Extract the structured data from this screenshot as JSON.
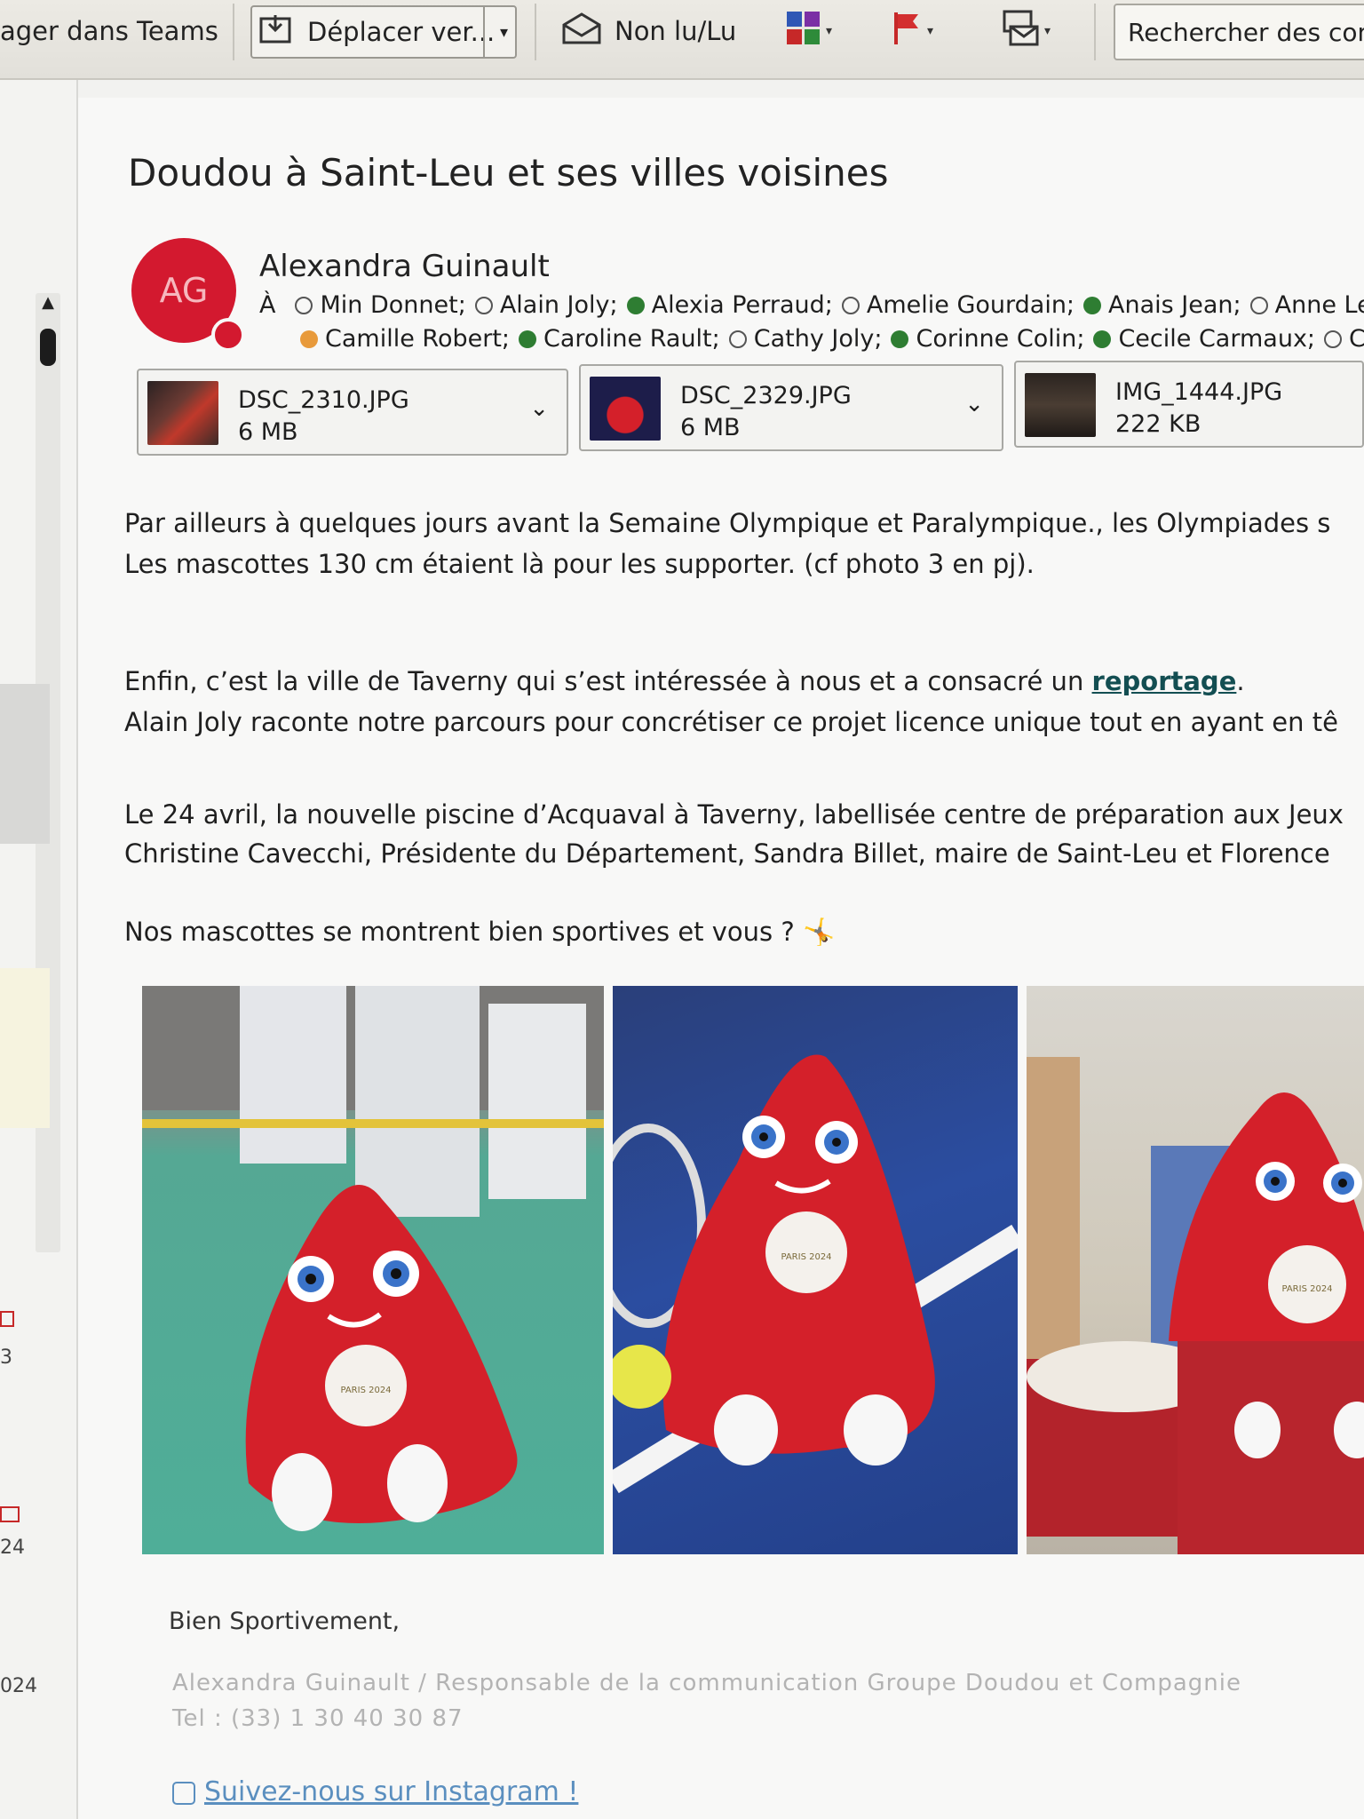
{
  "toolbar": {
    "teams_label": "ager dans Teams",
    "move_label": "Déplacer ver...",
    "unread_label": "Non lu/Lu",
    "search_label": "Rechercher des con"
  },
  "left_strip": {
    "frags": [
      "3",
      "24",
      "024"
    ]
  },
  "email": {
    "subject": "Doudou à Saint-Leu et ses villes voisines",
    "avatar_initials": "AG",
    "sender": "Alexandra Guinault",
    "to_label": "À",
    "recipients_line1": [
      {
        "name": "Min Donnet;",
        "status": "away"
      },
      {
        "name": "Alain Joly;",
        "status": "away"
      },
      {
        "name": "Alexia Perraud;",
        "status": "available"
      },
      {
        "name": "Amelie Gourdain;",
        "status": "away"
      },
      {
        "name": "Anais Jean;",
        "status": "available"
      },
      {
        "name": "Anne Le",
        "status": "away"
      }
    ],
    "recipients_line2": [
      {
        "name": "Camille Robert;",
        "status": "busy"
      },
      {
        "name": "Caroline Rault;",
        "status": "available"
      },
      {
        "name": "Cathy Joly;",
        "status": "away"
      },
      {
        "name": "Corinne Colin;",
        "status": "available"
      },
      {
        "name": "Cecile Carmaux;",
        "status": "available"
      },
      {
        "name": "Cle",
        "status": "away"
      }
    ],
    "attachments": [
      {
        "name": "DSC_2310.JPG",
        "size": "6 MB"
      },
      {
        "name": "DSC_2329.JPG",
        "size": "6 MB"
      },
      {
        "name": "IMG_1444.JPG",
        "size": "222 KB"
      }
    ],
    "para1_line1": "Par ailleurs à quelques jours avant la Semaine Olympique et Paralympique., les Olympiades s",
    "para1_line2": "Les mascottes 130 cm étaient là pour les supporter. (cf photo 3 en pj).",
    "para2_line1_before": "Enfin, c’est la ville de Taverny qui s’est intéressée à nous et a consacré un ",
    "para2_link": "reportage",
    "para2_line1_after": ".",
    "para2_line2": "Alain Joly raconte notre parcours pour concrétiser ce projet licence unique tout en ayant en tê",
    "para3_line1": "Le 24 avril, la nouvelle piscine d’Acquaval à Taverny, labellisée centre de préparation aux Jeux",
    "para3_line2": "Christine Cavecchi, Présidente du Département, Sandra Billet, maire de Saint-Leu et Florence",
    "para4": "Nos mascottes se montrent bien sportives et vous ?",
    "para4_emoji": "🤸",
    "mascot_badge": "PARIS 2024",
    "closing": "Bien Sportivement,",
    "signature_line1": "Alexandra Guinault / Responsable de la communication Groupe Doudou et Compagnie",
    "signature_line2": "Tel : (33) 1 30 40 30 87",
    "instagram_link": "Suivez-nous sur Instagram !"
  },
  "colors": {
    "mascot_red": "#d4202a",
    "avatar_red": "#d3192f",
    "status_green": "#2e7d32",
    "status_orange": "#e89a3b",
    "link_teal": "#134e52",
    "instagram_blue": "#5b8fbf"
  }
}
